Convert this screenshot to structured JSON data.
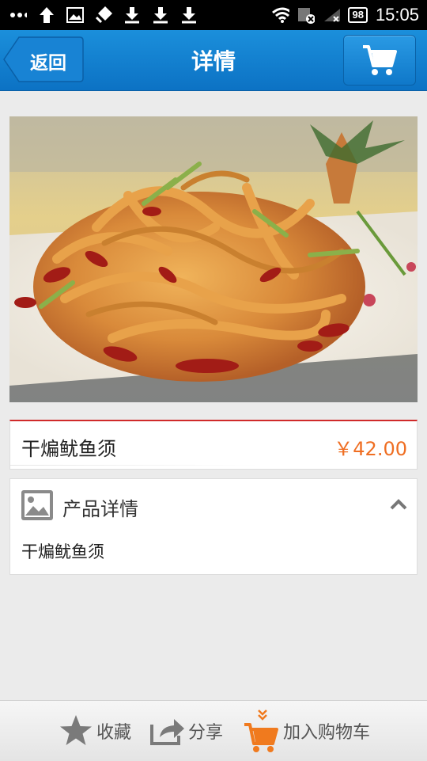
{
  "status_bar": {
    "time": "15:05",
    "battery": "98"
  },
  "header": {
    "back_label": "返回",
    "title": "详情"
  },
  "product": {
    "name": "干煸鱿鱼须",
    "price": "￥42.00"
  },
  "details": {
    "title": "产品详情",
    "body": "干煸鱿鱼须"
  },
  "bottom_bar": {
    "favorite_label": "收藏",
    "share_label": "分享",
    "add_to_cart_label": "加入购物车"
  },
  "colors": {
    "header_blue": "#1080d0",
    "price_orange": "#ef6e22",
    "accent_red": "#d02a2a",
    "cart_orange": "#f07a1e"
  },
  "icons": [
    "signal-dots-icon",
    "upload-icon",
    "image-icon",
    "notification-icon",
    "download-icon",
    "wifi-icon",
    "sim-icon",
    "signal-icon",
    "battery-icon",
    "back-arrow-icon",
    "cart-icon",
    "image-placeholder-icon",
    "chevron-up-icon",
    "star-icon",
    "share-icon",
    "add-cart-icon"
  ]
}
